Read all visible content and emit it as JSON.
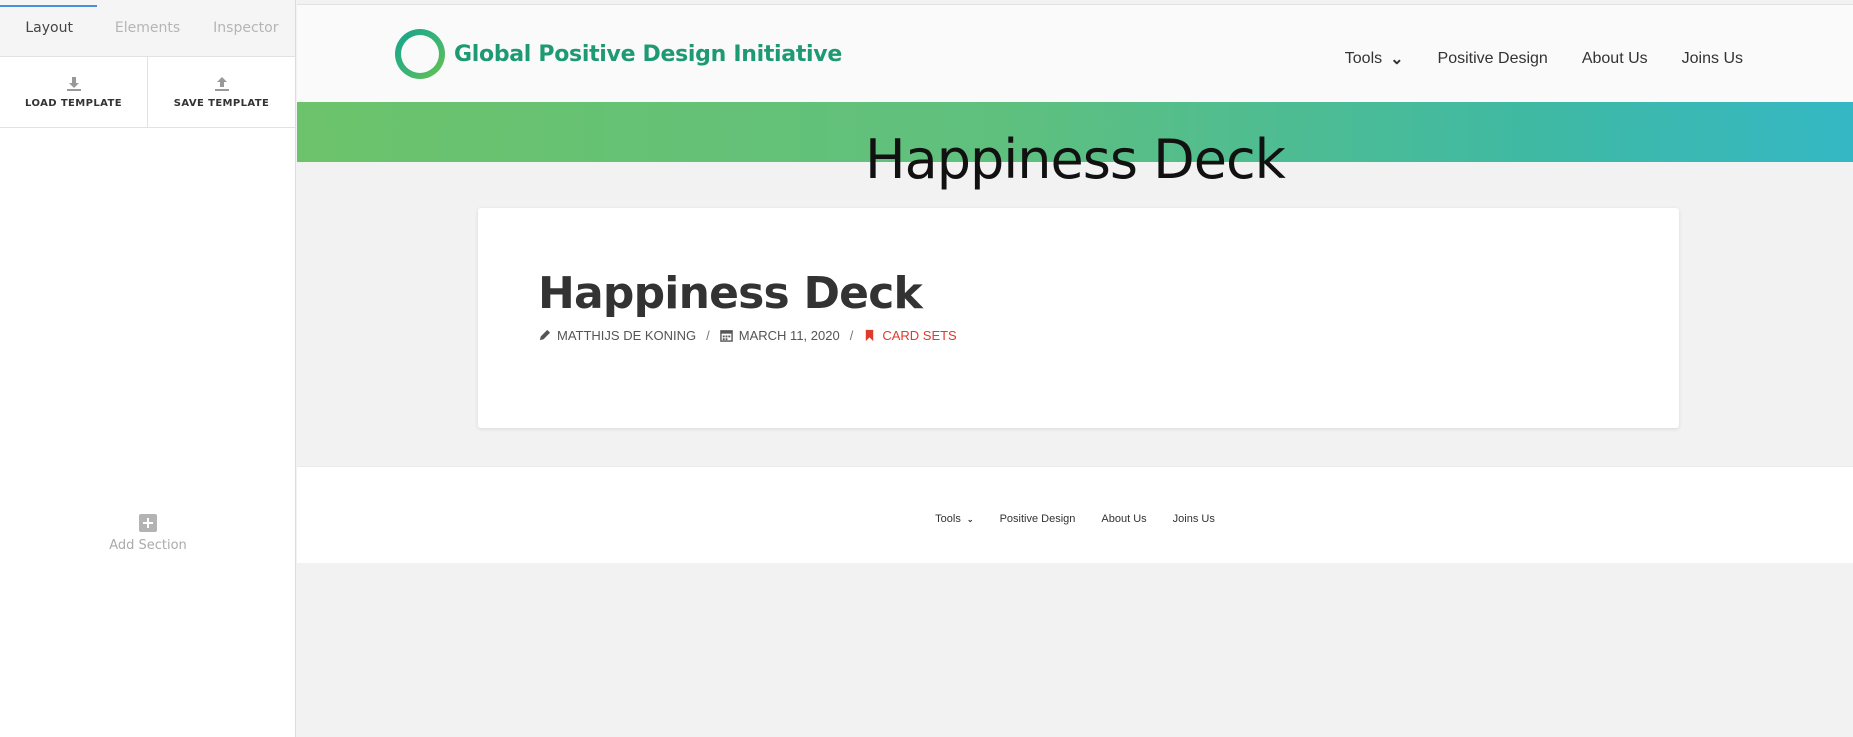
{
  "panel": {
    "tabs": [
      {
        "label": "Layout",
        "active": true
      },
      {
        "label": "Elements",
        "active": false
      },
      {
        "label": "Inspector",
        "active": false
      }
    ],
    "load_template": {
      "label": "LOAD TEMPLATE",
      "icon": "download-icon"
    },
    "save_template": {
      "label": "SAVE TEMPLATE",
      "icon": "upload-icon"
    },
    "add_section": {
      "label": "Add Section",
      "icon": "plus-square-icon"
    }
  },
  "site": {
    "logo_text": "Global Positive Design Initiative",
    "nav": {
      "tools": "Tools",
      "positive_design": "Positive Design",
      "about_us": "About Us",
      "joins_us": "Joins Us"
    },
    "hero_title": "Happiness Deck",
    "post": {
      "title": "Happiness Deck",
      "author": "MATTHIJS DE KONING",
      "date": "MARCH 11, 2020",
      "category": "CARD SETS",
      "separator": "/"
    },
    "footer_nav": {
      "tools": "Tools",
      "positive_design": "Positive Design",
      "about_us": "About Us",
      "joins_us": "Joins Us"
    }
  },
  "colors": {
    "accent_green": "#1e9a72",
    "category_red": "#e03a2c",
    "hero_gradient_start": "#6cc36b",
    "hero_gradient_end": "#35b8c4"
  }
}
